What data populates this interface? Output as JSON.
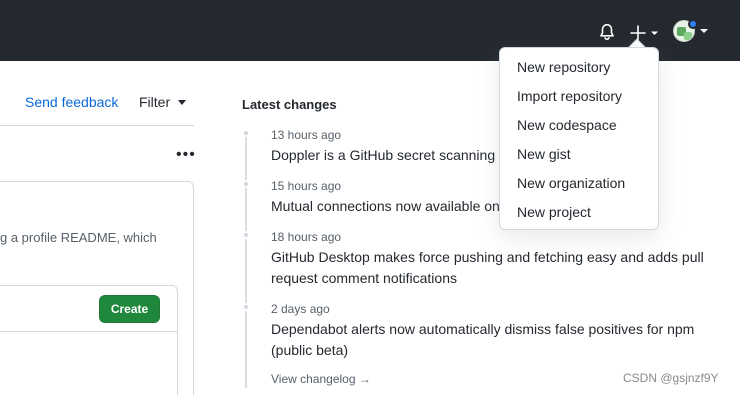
{
  "header": {
    "notifications_icon": "bell-icon",
    "create_icon": "plus-icon",
    "avatar_icon": "user-avatar"
  },
  "feed": {
    "send_feedback": "Send feedback",
    "filter_label": "Filter",
    "more_icon": "kebab-horizontal-icon",
    "more_glyph": "•••",
    "card_text": "g a profile README, which",
    "create_label": "Create"
  },
  "latest_changes": {
    "title": "Latest changes",
    "items": [
      {
        "time": "13 hours ago",
        "text": "Doppler is a GitHub secret scanning p"
      },
      {
        "time": "15 hours ago",
        "text": "Mutual connections now available on"
      },
      {
        "time": "18 hours ago",
        "text": "GitHub Desktop makes force pushing and fetching easy and adds pull request comment notifications"
      },
      {
        "time": "2 days ago",
        "text": "Dependabot alerts now automatically dismiss false positives for npm (public beta)"
      }
    ],
    "view_changelog": "View changelog →"
  },
  "create_menu": {
    "items": [
      "New repository",
      "Import repository",
      "New codespace",
      "New gist",
      "New organization",
      "New project"
    ]
  },
  "watermark": "CSDN @gsjnzf9Y",
  "colors": {
    "header_bg": "#24292f",
    "link": "#0969da",
    "create_button": "#1f883d",
    "notification_dot": "#2f81f7"
  }
}
